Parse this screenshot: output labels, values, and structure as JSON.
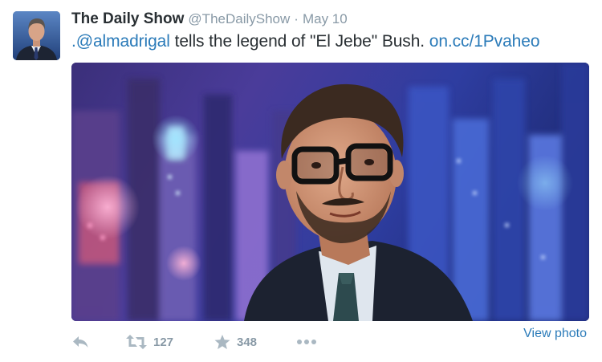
{
  "author": {
    "name": "The Daily Show",
    "handle": "@TheDailyShow",
    "separator": "·",
    "timestamp": "May 10"
  },
  "tweet": {
    "mention": ".@almadrigal",
    "text": " tells the legend of \"El Jebe\" Bush. ",
    "link": "on.cc/1Pvaheo"
  },
  "media": {
    "view_label": "View photo"
  },
  "actions": {
    "retweet_count": "127",
    "favorite_count": "348"
  },
  "icons": {
    "reply": "reply-icon",
    "retweet": "retweet-icon",
    "favorite": "star-icon",
    "more": "more-dots-icon"
  },
  "colors": {
    "text": "#292f33",
    "muted": "#8899a6",
    "link": "#2b7bb9",
    "icon": "#aab8c2"
  }
}
